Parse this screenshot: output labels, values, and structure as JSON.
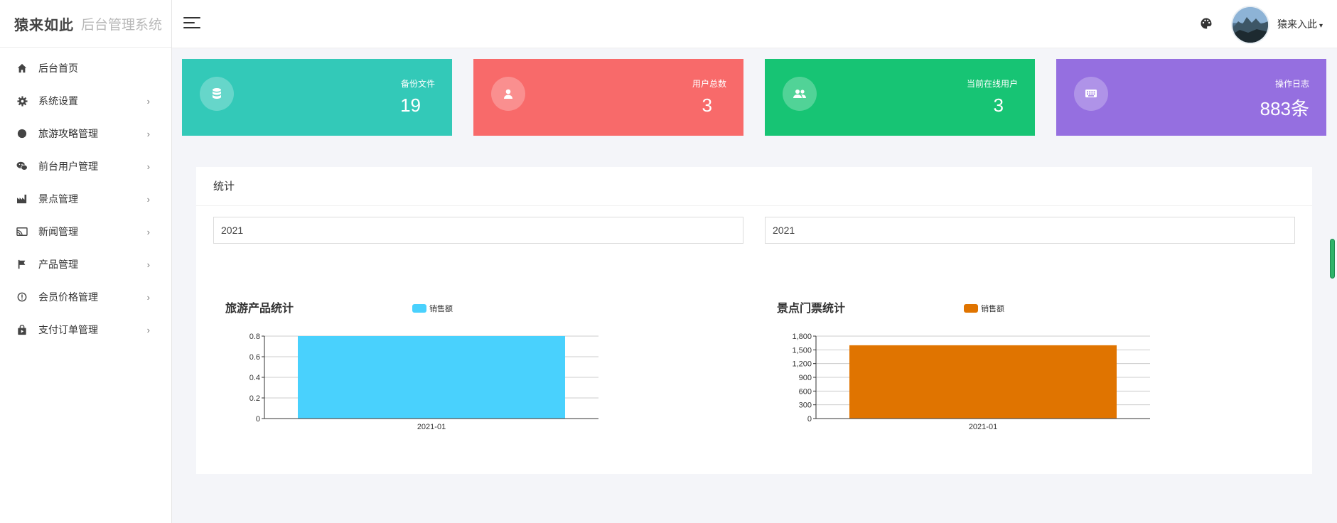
{
  "brand": {
    "logo": "猿来如此",
    "subtitle": "后台管理系统"
  },
  "sidebar": {
    "items": [
      {
        "label": "后台首页",
        "icon": "home-icon",
        "has_arrow": false
      },
      {
        "label": "系统设置",
        "icon": "gear-icon",
        "has_arrow": true
      },
      {
        "label": "旅游攻略管理",
        "icon": "circle-icon",
        "has_arrow": true
      },
      {
        "label": "前台用户管理",
        "icon": "wechat-icon",
        "has_arrow": true
      },
      {
        "label": "景点管理",
        "icon": "factory-icon",
        "has_arrow": true
      },
      {
        "label": "新闻管理",
        "icon": "cast-icon",
        "has_arrow": true
      },
      {
        "label": "产品管理",
        "icon": "flag-icon",
        "has_arrow": true
      },
      {
        "label": "会员价格管理",
        "icon": "alert-circle-icon",
        "has_arrow": true
      },
      {
        "label": "支付订单管理",
        "icon": "shopping-bag-icon",
        "has_arrow": true
      }
    ],
    "arrow": "›"
  },
  "header": {
    "username": "猿来入此",
    "caret": "▾"
  },
  "cards": [
    {
      "label": "备份文件",
      "value": "19",
      "icon": "database-icon",
      "color": "#33c9b8"
    },
    {
      "label": "用户总数",
      "value": "3",
      "icon": "user-icon",
      "color": "#f86a6a"
    },
    {
      "label": "当前在线用户",
      "value": "3",
      "icon": "users-icon",
      "color": "#17c474"
    },
    {
      "label": "操作日志",
      "value": "883条",
      "icon": "keyboard-icon",
      "color": "#956fe0"
    }
  ],
  "panel": {
    "title": "统计",
    "year_left": "2021",
    "year_right": "2021"
  },
  "chart_data": [
    {
      "type": "bar",
      "title": "旅游产品统计",
      "categories": [
        "2021-01"
      ],
      "series": [
        {
          "name": "销售额",
          "values": [
            0.8
          ]
        }
      ],
      "ylim": [
        0,
        0.8
      ],
      "yticks": [
        "0",
        "0.2",
        "0.4",
        "0.6",
        "0.8"
      ],
      "ytick_values": [
        0,
        0.2,
        0.4,
        0.6,
        0.8
      ],
      "color": "#49d1fd",
      "grid": true,
      "legend": "top"
    },
    {
      "type": "bar",
      "title": "景点门票统计",
      "categories": [
        "2021-01"
      ],
      "series": [
        {
          "name": "销售额",
          "values": [
            1600
          ]
        }
      ],
      "ylim": [
        0,
        1800
      ],
      "yticks": [
        "0",
        "300",
        "600",
        "900",
        "1,200",
        "1,500",
        "1,800"
      ],
      "ytick_values": [
        0,
        300,
        600,
        900,
        1200,
        1500,
        1800
      ],
      "color": "#e07400",
      "grid": true,
      "legend": "top"
    }
  ]
}
